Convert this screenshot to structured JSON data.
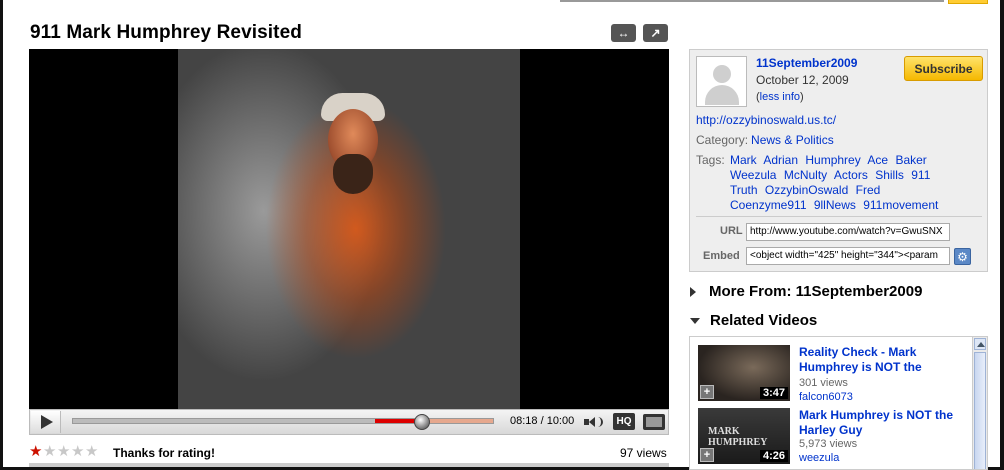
{
  "video": {
    "title": "911 Mark Humphrey Revisited",
    "time": "08:18 / 10:00",
    "progress": 0.83,
    "quality_label": "HQ"
  },
  "rating": {
    "stars_filled": 1,
    "stars_total": 5,
    "message": "Thanks for rating!",
    "views": "97 views"
  },
  "info": {
    "channel": "11September2009",
    "date": "October 12, 2009",
    "less_open": "(",
    "less_link": "less info",
    "less_close": ")",
    "subscribe": "Subscribe",
    "site_link": "http://ozzybinoswald.us.tc/",
    "category_label": "Category:",
    "category": "News & Politics",
    "tags_label": "Tags:",
    "tags": [
      "Mark",
      "Adrian",
      "Humphrey",
      "Ace",
      "Baker",
      "Weezula",
      "McNulty",
      "Actors",
      "Shills",
      "911",
      "Truth",
      "OzzybinOswald",
      "Fred",
      "Coenzyme911",
      "9llNews",
      "911movement"
    ],
    "url_label": "URL",
    "url_value": "http://www.youtube.com/watch?v=GwuSNX",
    "embed_label": "Embed",
    "embed_value": "<object width=\"425\" height=\"344\"><param"
  },
  "sections": {
    "more_from": "More From: 11September2009",
    "related": "Related Videos"
  },
  "related": [
    {
      "title": "Reality Check - Mark Humphrey is NOT the",
      "views": "301 views",
      "user": "falcon6073",
      "duration": "3:47",
      "thumb_caption": ""
    },
    {
      "title": "Mark Humphrey is NOT the Harley Guy",
      "views": "5,973 views",
      "user": "weezula",
      "duration": "4:26",
      "thumb_caption": "MARK HUMPHREY"
    }
  ],
  "icons": {
    "wide": "↔",
    "popout": "↗",
    "plus": "+",
    "gear": "⚙",
    "star": "★"
  },
  "colors": {
    "link": "#0033cc",
    "subscribe": "#f5b800",
    "played": "#dd0000",
    "star_on": "#cc1100"
  }
}
